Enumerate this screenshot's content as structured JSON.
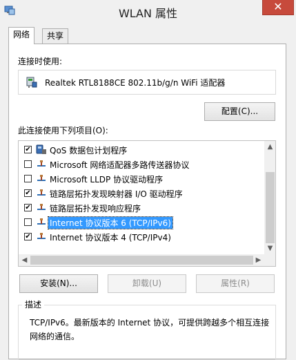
{
  "window": {
    "title": "WLAN 属性",
    "close_glyph": "✕"
  },
  "tabs": [
    {
      "label": "网络"
    },
    {
      "label": "共享"
    }
  ],
  "connect_using": {
    "label": "连接时使用:",
    "adapter_name": "Realtek RTL8188CE 802.11b/g/n WiFi 适配器",
    "adapter_icon": "network-adapter-icon"
  },
  "buttons": {
    "configure": "配置(C)...",
    "install": "安装(N)...",
    "uninstall": "卸载(U)",
    "properties": "属性(R)"
  },
  "items_label": "此连接使用下列项目(O):",
  "items": [
    {
      "label": "QoS 数据包计划程序",
      "checked": true,
      "icon": "qos-icon"
    },
    {
      "label": "Microsoft 网络适配器多路传送器协议",
      "checked": false,
      "icon": "protocol-icon"
    },
    {
      "label": "Microsoft LLDP 协议驱动程序",
      "checked": false,
      "icon": "protocol-icon"
    },
    {
      "label": "链路层拓扑发现映射器 I/O 驱动程序",
      "checked": true,
      "icon": "protocol-icon"
    },
    {
      "label": "链路层拓扑发现响应程序",
      "checked": true,
      "icon": "protocol-icon"
    },
    {
      "label": "Internet 协议版本 6 (TCP/IPv6)",
      "checked": false,
      "icon": "protocol-icon",
      "selected": true
    },
    {
      "label": "Internet 协议版本 4 (TCP/IPv4)",
      "checked": true,
      "icon": "protocol-icon"
    }
  ],
  "scroll_arrows": {
    "up": "▲",
    "down": "▼",
    "left": "◀",
    "right": "▶"
  },
  "description": {
    "title": "描述",
    "text": "TCP/IPv6。最新版本的 Internet 协议，可提供跨越多个相互连接网络的通信。"
  },
  "colors": {
    "selection": "#3399ff",
    "close_button": "#c74a3c"
  }
}
